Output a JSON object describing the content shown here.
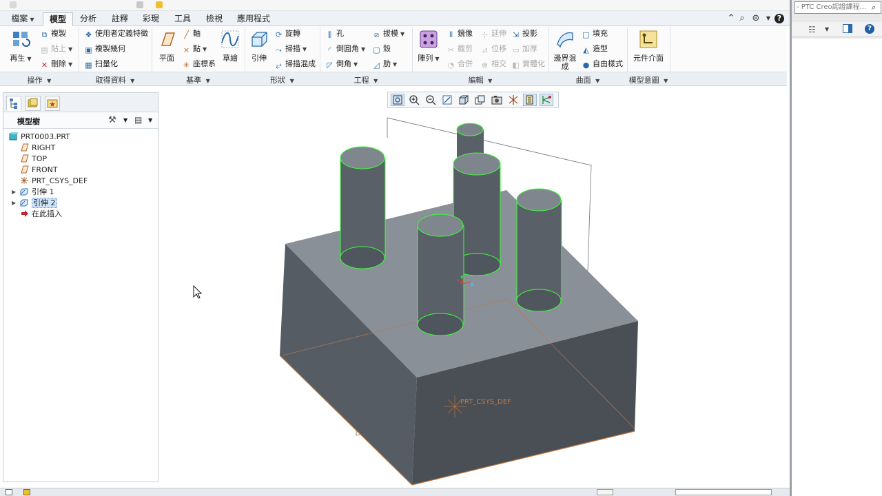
{
  "ribbon": {
    "tabs": [
      {
        "label": "檔案",
        "dropdown": true
      },
      {
        "label": "模型",
        "active": true
      },
      {
        "label": "分析"
      },
      {
        "label": "註釋"
      },
      {
        "label": "彩現"
      },
      {
        "label": "工具"
      },
      {
        "label": "檢視"
      },
      {
        "label": "應用程式"
      }
    ],
    "operations": {
      "regenerate": "再生",
      "copy": "複製",
      "paste": "貼上",
      "delete": "刪除",
      "label": "操作"
    },
    "get_data": {
      "udf": "使用者定義特徵",
      "copy_geometry": "複製幾何",
      "shrinkwrap": "扫量化",
      "label": "取得資料"
    },
    "datum": {
      "plane": "平面",
      "axis": "軸",
      "point": "點",
      "csys": "座標系",
      "sketch": "草繪",
      "label": "基準"
    },
    "shapes": {
      "extrude": "引伸",
      "revolve": "旋轉",
      "sweep": "掃描",
      "swept_blend": "掃描混成",
      "label": "形狀"
    },
    "engineering": {
      "hole": "孔",
      "round": "倒圓角",
      "chamfer": "倒角",
      "draft": "拔模",
      "shell": "殼",
      "rib": "肋",
      "label": "工程"
    },
    "editing": {
      "pattern": "陣列",
      "mirror": "鏡像",
      "extend": "延伸",
      "project": "投影",
      "trim": "截剪",
      "offset": "位移",
      "thicken": "加厚",
      "merge": "合併",
      "intersect": "相交",
      "solidify": "實體化",
      "label": "編輯"
    },
    "surfaces": {
      "boundary_blend": "邊界混成",
      "fill": "填充",
      "style": "造型",
      "freestyle": "自由樣式",
      "label": "曲面"
    },
    "model_intent": {
      "component_interface": "元件介面",
      "label": "模型意圖"
    }
  },
  "right_panel": {
    "address_text": "- PTC Creo認證課程..."
  },
  "model_tree": {
    "title": "模型樹",
    "items": [
      {
        "label": "PRT0003.PRT",
        "icon": "part-icon"
      },
      {
        "label": "RIGHT",
        "icon": "datum-plane-icon"
      },
      {
        "label": "TOP",
        "icon": "datum-plane-icon"
      },
      {
        "label": "FRONT",
        "icon": "datum-plane-icon"
      },
      {
        "label": "PRT_CSYS_DEF",
        "icon": "csys-icon"
      },
      {
        "label": "引伸 1",
        "icon": "extrude-icon",
        "expandable": true
      },
      {
        "label": "引伸 2",
        "icon": "extrude-icon",
        "expandable": true,
        "selected": true
      },
      {
        "label": "在此插入",
        "icon": "insert-arrow-icon"
      }
    ]
  },
  "viewport": {
    "csys_label": "PRT_CSYS_DEF",
    "toolbar_icons": [
      "refit-icon",
      "zoom-in-icon",
      "zoom-out-icon",
      "repaint-icon",
      "display-style-icon",
      "saved-views-icon",
      "view-manager-icon",
      "datum-display-icon",
      "spin-center-icon",
      "annotation-display-icon"
    ]
  },
  "colors": {
    "body_top": "#8a9097",
    "body_front": "#565c63",
    "body_side": "#4a4f55",
    "highlight": "#3cff3c",
    "datum_edge": "#c87a3c"
  }
}
